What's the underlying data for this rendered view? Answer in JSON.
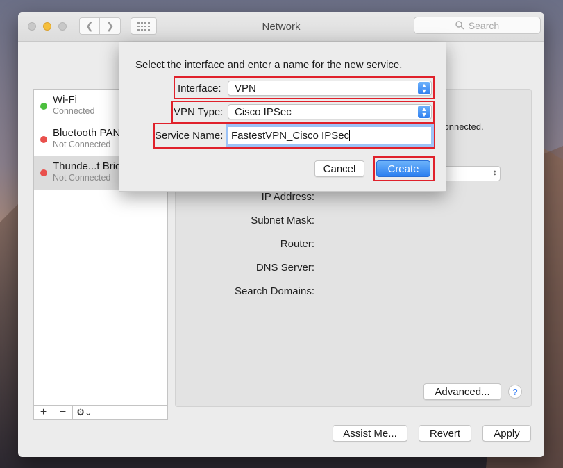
{
  "window": {
    "title": "Network",
    "search_placeholder": "Search"
  },
  "colors": {
    "connected": "#4cbf3e",
    "disconnected": "#e9504c",
    "accent": "#2f7ff0",
    "highlight": "#e0212b"
  },
  "sidebar": {
    "items": [
      {
        "name": "Wi-Fi",
        "status": "Connected",
        "state": "connected"
      },
      {
        "name": "Bluetooth PAN",
        "status": "Not Connected",
        "state": "disconnected"
      },
      {
        "name": "Thunde...t Bridge",
        "status": "Not Connected",
        "state": "disconnected"
      }
    ],
    "add_label": "+",
    "remove_label": "−",
    "gear_label": "⚙⌄"
  },
  "detail": {
    "status_fragment": "connected.",
    "fields": [
      {
        "label": "IP Address:"
      },
      {
        "label": "Subnet Mask:"
      },
      {
        "label": "Router:"
      },
      {
        "label": "DNS Server:"
      },
      {
        "label": "Search Domains:"
      }
    ],
    "advanced_label": "Advanced...",
    "help_label": "?"
  },
  "footer": {
    "assist_label": "Assist Me...",
    "revert_label": "Revert",
    "apply_label": "Apply"
  },
  "sheet": {
    "title": "Select the interface and enter a name for the new service.",
    "interface_label": "Interface:",
    "interface_value": "VPN",
    "vpn_type_label": "VPN Type:",
    "vpn_type_value": "Cisco IPSec",
    "service_name_label": "Service Name:",
    "service_name_value": "FastestVPN_Cisco IPSec",
    "cancel_label": "Cancel",
    "create_label": "Create"
  }
}
